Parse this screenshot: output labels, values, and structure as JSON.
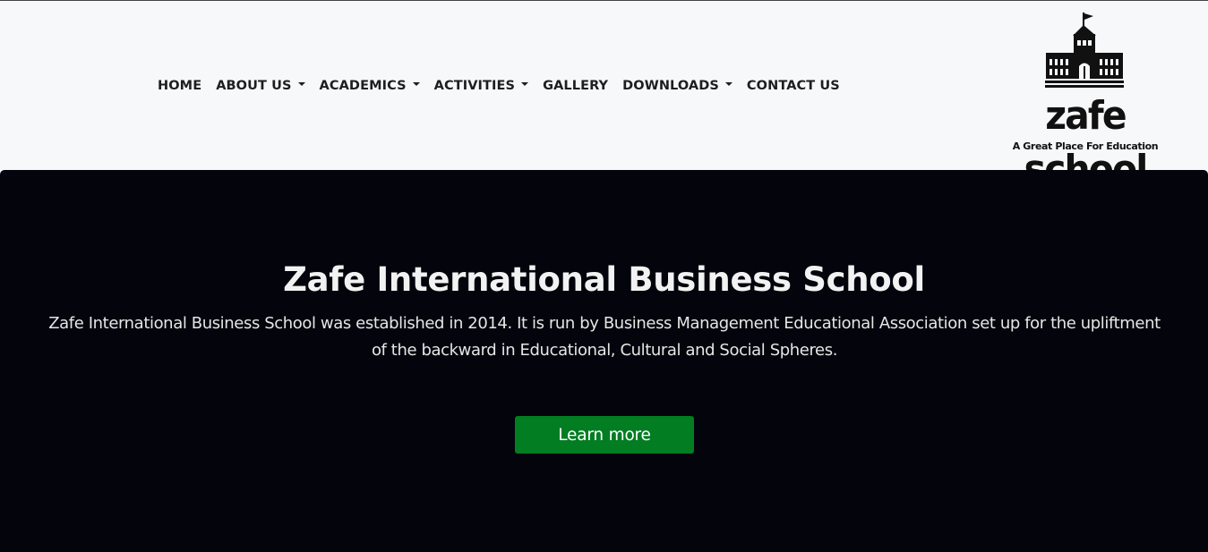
{
  "nav": {
    "items": [
      {
        "label": "HOME",
        "dropdown": false
      },
      {
        "label": "ABOUT US",
        "dropdown": true
      },
      {
        "label": "ACADEMICS",
        "dropdown": true
      },
      {
        "label": "ACTIVITIES",
        "dropdown": true
      },
      {
        "label": "GALLERY",
        "dropdown": false
      },
      {
        "label": "DOWNLOADS",
        "dropdown": true
      },
      {
        "label": "CONTACT US",
        "dropdown": false
      }
    ]
  },
  "logo": {
    "icon": "school-building-icon",
    "name": "zafe school",
    "tagline": "A Great Place For Education"
  },
  "hero": {
    "title": "Zafe International Business School",
    "description": "Zafe International Business School was established in 2014. It is run by Business Management Educational Association set up for the upliftment of the backward in Educational, Cultural and Social Spheres.",
    "button_label": "Learn more"
  },
  "colors": {
    "navbar_bg": "#f7f8fa",
    "hero_bg": "#03040c",
    "button_bg": "#027d22",
    "nav_text": "#1e1e1e"
  }
}
